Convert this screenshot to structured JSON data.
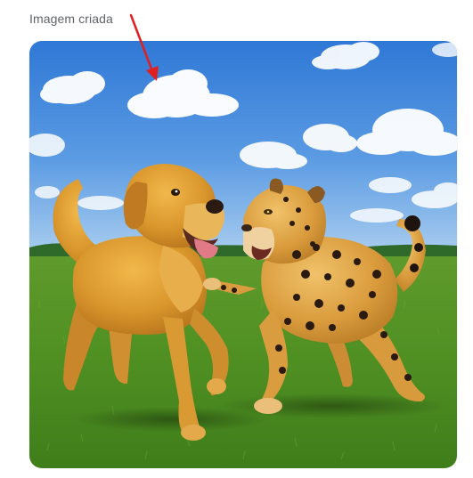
{
  "caption": "Imagem criada",
  "image": {
    "alt": "",
    "subjects": [
      "golden-retriever",
      "jaguar"
    ]
  },
  "annotation": {
    "arrow_color": "#e02020"
  }
}
